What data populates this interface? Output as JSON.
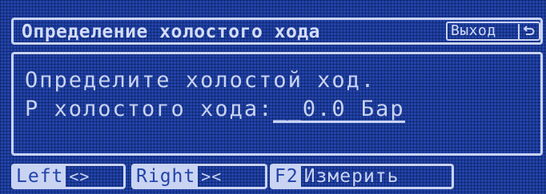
{
  "header": {
    "title": "Определение холостого хода",
    "exit_label": "Выход",
    "exit_icon": "return-arrow-icon"
  },
  "panel": {
    "line1": "Определите холостой ход.",
    "line2_label": "P холостого хода:",
    "value": "__0.0",
    "unit": " Бар"
  },
  "softkeys": [
    {
      "key": "Left",
      "glyph": "<>",
      "icon": "chevrons-apart-icon"
    },
    {
      "key": "Right",
      "glyph": "><",
      "icon": "chevrons-together-icon"
    },
    {
      "key": "F2",
      "text": "Измерить"
    }
  ],
  "colors": {
    "background": "#2244a8",
    "foreground": "#c9d3f2",
    "grid": "#0a195a"
  }
}
